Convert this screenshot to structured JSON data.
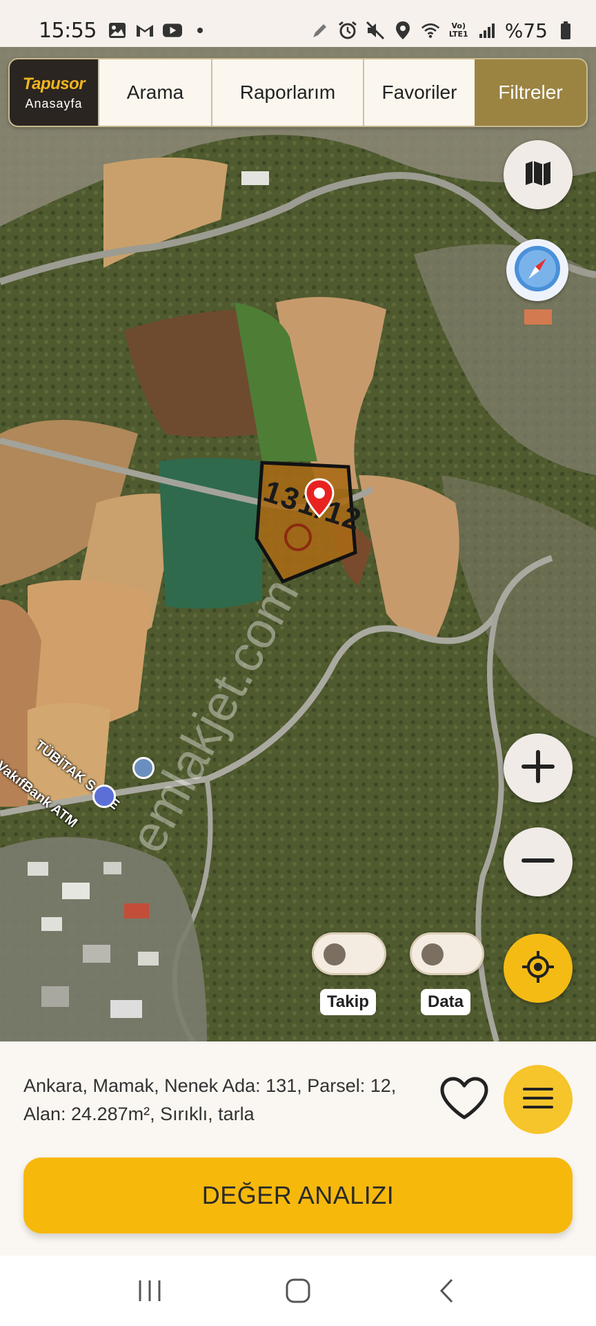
{
  "status_bar": {
    "time": "15:55",
    "battery": "%75",
    "left_icons": [
      "gallery-icon",
      "gmail-icon",
      "youtube-icon",
      "dot-icon"
    ],
    "right_icons": [
      "pen-icon",
      "alarm-icon",
      "mute-icon",
      "location-icon",
      "wifi-icon",
      "volte-icon",
      "signal-icon",
      "battery-icon"
    ],
    "volte_label": "Vo) LTE1"
  },
  "nav": {
    "brand": "Tapusor",
    "home_label": "Anasayfa",
    "tabs": [
      {
        "label": "Arama"
      },
      {
        "label": "Raporlarım"
      },
      {
        "label": "Favoriler"
      },
      {
        "label": "Filtreler",
        "active": true
      }
    ]
  },
  "map": {
    "parcel_label": "131/12",
    "watermark": "emlakjet.com",
    "poi_1": "TÜBİTAK SAGE",
    "poi_2": "VakıfBank ATM",
    "controls": [
      "map-layers-icon",
      "compass-icon",
      "zoom-in-icon",
      "zoom-out-icon",
      "locate-icon"
    ]
  },
  "toggles": {
    "takip": {
      "label": "Takip",
      "on": false
    },
    "data": {
      "label": "Data",
      "on": false
    }
  },
  "panel": {
    "info_line1": "Ankara, Mamak, Nenek Ada: 131, Parsel: 12,",
    "info_line2": "Alan: 24.287m², Sırıklı, tarla",
    "cta_label": "DEĞER ANALIZI"
  },
  "colors": {
    "accent_yellow": "#f7b80c",
    "active_tab": "#9b8442",
    "brand_dark": "#2a2520",
    "parcel_fill": "#a86a16"
  }
}
